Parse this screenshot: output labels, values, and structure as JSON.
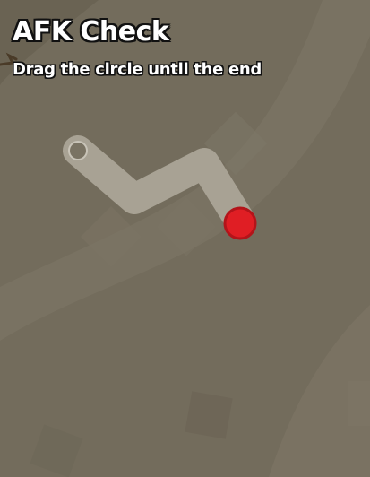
{
  "dialog": {
    "title": "AFK Check",
    "instruction": "Drag the circle until the end"
  },
  "colors": {
    "background": "#716a5a",
    "track": "#a8a294",
    "handle": "#e01e24",
    "handle_border": "#b3141a",
    "text": "#ffffff",
    "text_outline": "#111111"
  },
  "icons": {
    "start_marker": "hollow-circle",
    "drag_handle": "red-circle"
  }
}
